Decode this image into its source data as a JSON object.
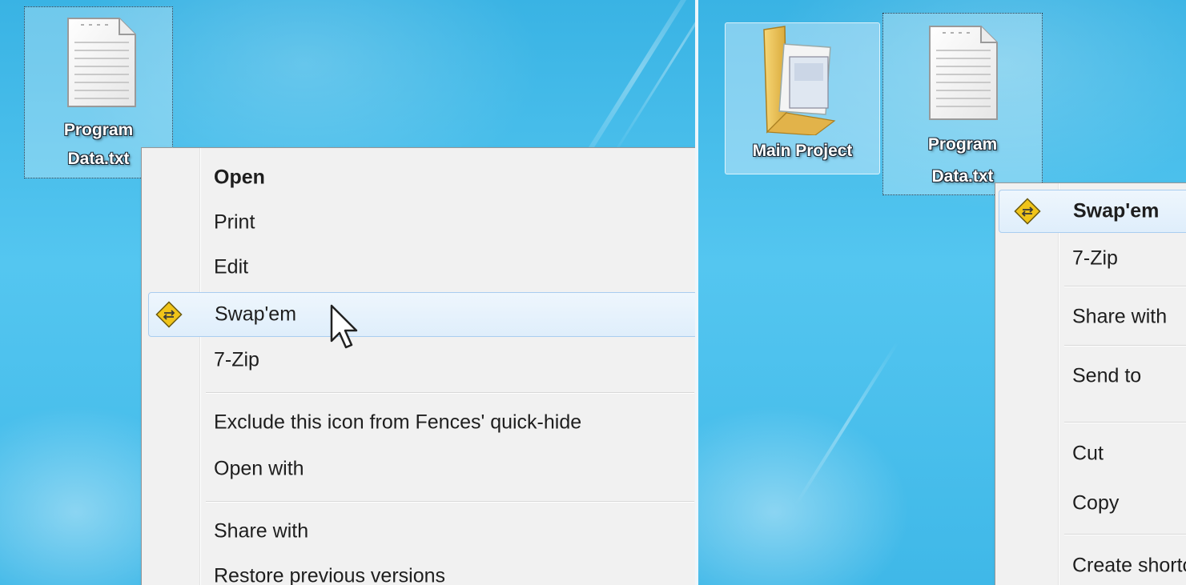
{
  "left": {
    "icon": {
      "label_line1": "Program",
      "label_line2": "Data.txt",
      "icon_name": "text-file-icon"
    },
    "menu": {
      "items": [
        {
          "label": "Open",
          "bold": true
        },
        {
          "label": "Print"
        },
        {
          "label": "Edit"
        },
        {
          "label": "Swap'em",
          "icon": "swapem-icon",
          "highlighted": true
        },
        {
          "label": "7-Zip"
        },
        {
          "label": "Exclude this icon from Fences' quick-hide"
        },
        {
          "label": "Open with"
        },
        {
          "label": "Share with"
        },
        {
          "label": "Restore previous versions"
        }
      ]
    }
  },
  "right": {
    "folder": {
      "label": "Main Project",
      "icon_name": "folder-icon"
    },
    "icon": {
      "label_line1": "Program",
      "label_line2": "Data.txt",
      "icon_name": "text-file-icon"
    },
    "menu": {
      "items": [
        {
          "label": "Swap'em",
          "bold": true,
          "icon": "swapem-icon",
          "highlighted": true
        },
        {
          "label": "7-Zip"
        },
        {
          "label": "Share with"
        },
        {
          "label": "Send to"
        },
        {
          "label": "Cut"
        },
        {
          "label": "Copy"
        },
        {
          "label": "Create shortcut"
        }
      ]
    }
  },
  "colors": {
    "desktop": "#4cc2ee",
    "menu_bg": "#f1f1f1",
    "highlight_border": "#a9cdf0"
  }
}
